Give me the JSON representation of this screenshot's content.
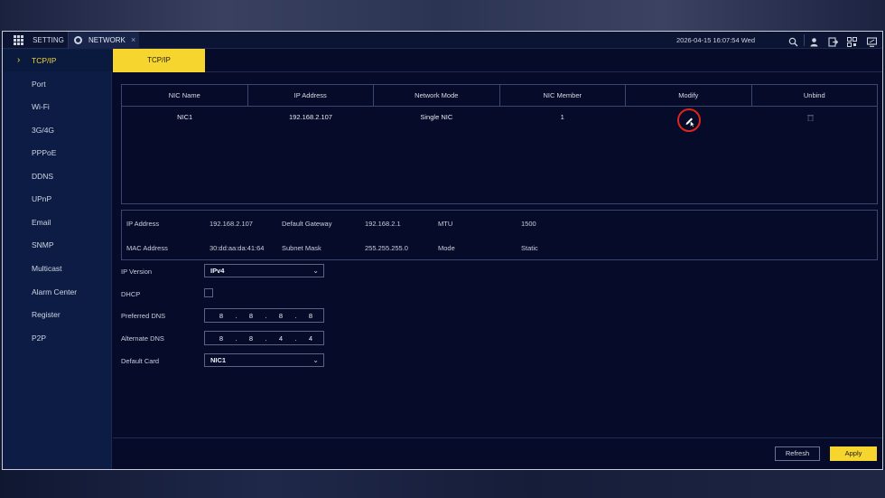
{
  "titlebar": {
    "menu_tab": "SETTING",
    "active_tab": "NETWORK",
    "close_glyph": "×",
    "datetime": "2026-04-15 16:07:54 Wed",
    "icons": [
      "search-icon",
      "user-icon",
      "logout-icon",
      "qr-code-icon",
      "monitor-icon"
    ]
  },
  "sidebar": {
    "items": [
      {
        "label": "TCP/IP",
        "active": true
      },
      {
        "label": "Port"
      },
      {
        "label": "Wi-Fi"
      },
      {
        "label": "3G/4G"
      },
      {
        "label": "PPPoE"
      },
      {
        "label": "DDNS"
      },
      {
        "label": "UPnP"
      },
      {
        "label": "Email"
      },
      {
        "label": "SNMP"
      },
      {
        "label": "Multicast"
      },
      {
        "label": "Alarm Center"
      },
      {
        "label": "Register"
      },
      {
        "label": "P2P"
      }
    ]
  },
  "subtab": {
    "label": "TCP/IP"
  },
  "nic_table": {
    "headers": [
      "NIC Name",
      "IP Address",
      "Network Mode",
      "NIC Member",
      "Modify",
      "Unbind"
    ],
    "rows": [
      {
        "name": "NIC1",
        "ip": "192.168.2.107",
        "mode": "Single NIC",
        "member": "1"
      }
    ]
  },
  "info": {
    "ip_address_label": "IP Address",
    "ip_address": "192.168.2.107",
    "gateway_label": "Default Gateway",
    "gateway": "192.168.2.1",
    "mtu_label": "MTU",
    "mtu": "1500",
    "mac_label": "MAC Address",
    "mac": "30:dd:aa:da:41:64",
    "mask_label": "Subnet Mask",
    "mask": "255.255.255.0",
    "mode_label": "Mode",
    "mode": "Static"
  },
  "form": {
    "ip_version_label": "IP Version",
    "ip_version": "IPv4",
    "dhcp_label": "DHCP",
    "dhcp_checked": false,
    "preferred_dns_label": "Preferred DNS",
    "preferred_dns": [
      "8",
      "8",
      "8",
      "8"
    ],
    "alternate_dns_label": "Alternate DNS",
    "alternate_dns": [
      "8",
      "8",
      "4",
      "4"
    ],
    "default_card_label": "Default Card",
    "default_card": "NIC1"
  },
  "buttons": {
    "refresh": "Refresh",
    "apply": "Apply"
  },
  "colors": {
    "accent": "#f6d52e",
    "highlight_ring": "#e0251f",
    "background": "#050b28"
  }
}
